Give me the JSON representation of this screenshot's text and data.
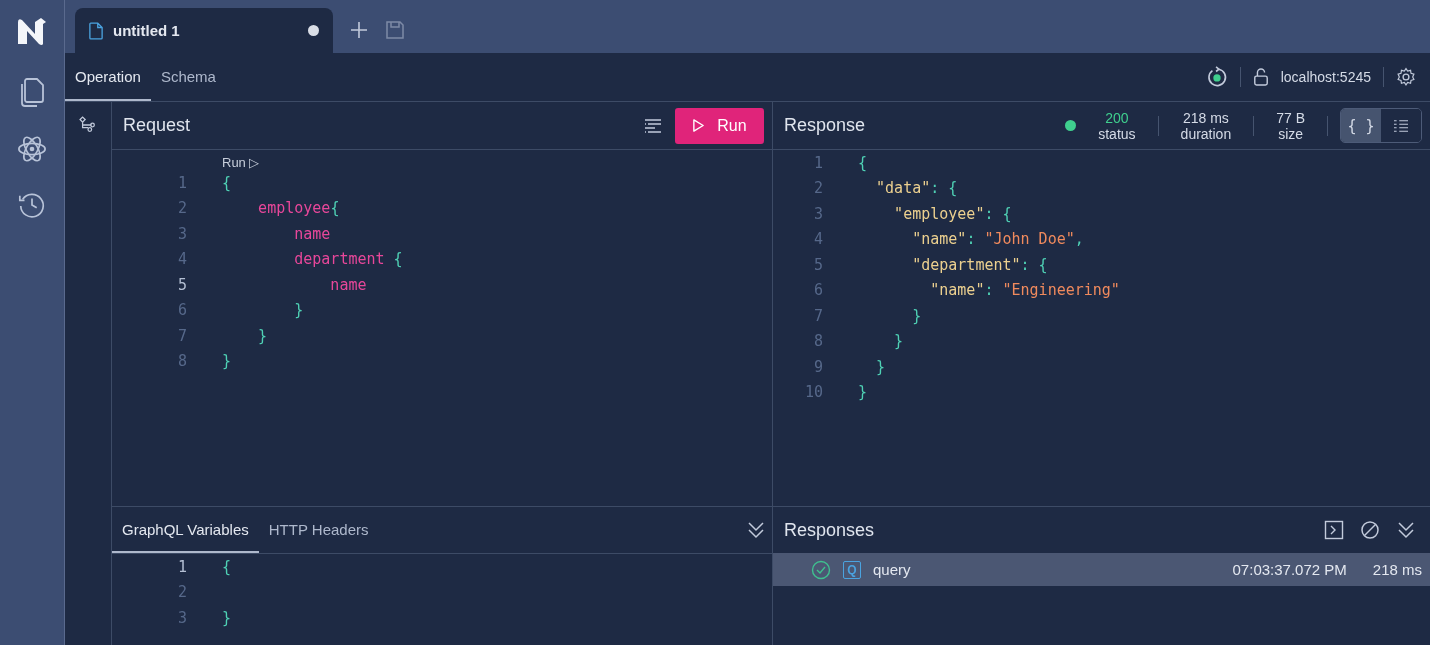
{
  "tabs": [
    {
      "title": "untitled 1",
      "unsaved": true,
      "selected": true
    }
  ],
  "operation_tabs": [
    {
      "label": "Operation",
      "selected": true
    },
    {
      "label": "Schema",
      "selected": false
    }
  ],
  "connection": {
    "endpoint": "localhost:5245"
  },
  "request": {
    "title": "Request",
    "run_button": "Run",
    "codelens": "Run ▷",
    "lines": [
      {
        "number": "1",
        "active": false,
        "tokens": [
          {
            "kind": "punct",
            "text": "{"
          }
        ]
      },
      {
        "number": "2",
        "active": false,
        "tokens": [
          {
            "kind": "field",
            "text": "    employee"
          },
          {
            "kind": "punct",
            "text": "{"
          }
        ]
      },
      {
        "number": "3",
        "active": false,
        "tokens": [
          {
            "kind": "field",
            "text": "        name"
          }
        ]
      },
      {
        "number": "4",
        "active": false,
        "tokens": [
          {
            "kind": "field",
            "text": "        department "
          },
          {
            "kind": "punct",
            "text": "{"
          }
        ]
      },
      {
        "number": "5",
        "active": true,
        "tokens": [
          {
            "kind": "field",
            "text": "            name"
          }
        ]
      },
      {
        "number": "6",
        "active": false,
        "tokens": [
          {
            "kind": "punct",
            "text": "        }"
          }
        ]
      },
      {
        "number": "7",
        "active": false,
        "tokens": [
          {
            "kind": "punct",
            "text": "    }"
          }
        ]
      },
      {
        "number": "8",
        "active": false,
        "tokens": [
          {
            "kind": "punct",
            "text": "}"
          }
        ]
      }
    ]
  },
  "response": {
    "title": "Response",
    "status": {
      "value": "200",
      "label": "status",
      "success": true
    },
    "duration": {
      "value": "218 ms",
      "label": "duration"
    },
    "size": {
      "value": "77 B",
      "label": "size"
    },
    "view_modes": [
      {
        "kind": "json",
        "label": "{ }",
        "selected": true
      },
      {
        "kind": "list",
        "selected": false
      }
    ],
    "lines": [
      {
        "number": "1",
        "tokens": [
          {
            "kind": "punct",
            "text": "{"
          }
        ]
      },
      {
        "number": "2",
        "tokens": [
          {
            "kind": "key",
            "text": "  \"data\""
          },
          {
            "kind": "punct",
            "text": ": {"
          }
        ]
      },
      {
        "number": "3",
        "tokens": [
          {
            "kind": "key",
            "text": "    \"employee\""
          },
          {
            "kind": "punct",
            "text": ": {"
          }
        ]
      },
      {
        "number": "4",
        "tokens": [
          {
            "kind": "key",
            "text": "      \"name\""
          },
          {
            "kind": "punct",
            "text": ": "
          },
          {
            "kind": "string",
            "text": "\"John Doe\""
          },
          {
            "kind": "punct",
            "text": ","
          }
        ]
      },
      {
        "number": "5",
        "tokens": [
          {
            "kind": "key",
            "text": "      \"department\""
          },
          {
            "kind": "punct",
            "text": ": {"
          }
        ]
      },
      {
        "number": "6",
        "tokens": [
          {
            "kind": "key",
            "text": "        \"name\""
          },
          {
            "kind": "punct",
            "text": ": "
          },
          {
            "kind": "string",
            "text": "\"Engineering\""
          }
        ]
      },
      {
        "number": "7",
        "tokens": [
          {
            "kind": "punct",
            "text": "      }"
          }
        ]
      },
      {
        "number": "8",
        "tokens": [
          {
            "kind": "punct",
            "text": "    }"
          }
        ]
      },
      {
        "number": "9",
        "tokens": [
          {
            "kind": "punct",
            "text": "  }"
          }
        ]
      },
      {
        "number": "10",
        "tokens": [
          {
            "kind": "punct",
            "text": "}"
          }
        ]
      }
    ]
  },
  "variables_panel": {
    "tabs": [
      {
        "label": "GraphQL Variables",
        "selected": true
      },
      {
        "label": "HTTP Headers",
        "selected": false
      }
    ],
    "lines": [
      {
        "number": "1",
        "active": true,
        "tokens": [
          {
            "kind": "punct",
            "text": "{"
          }
        ]
      },
      {
        "number": "2",
        "active": false
      },
      {
        "number": "3",
        "active": false,
        "tokens": [
          {
            "kind": "punct",
            "text": "}"
          }
        ]
      }
    ]
  },
  "responses_panel": {
    "title": "Responses",
    "items": [
      {
        "success": true,
        "type_badge": "Q",
        "name": "query",
        "time": "07:03:37.072 PM",
        "duration": "218 ms",
        "selected": true
      }
    ]
  }
}
